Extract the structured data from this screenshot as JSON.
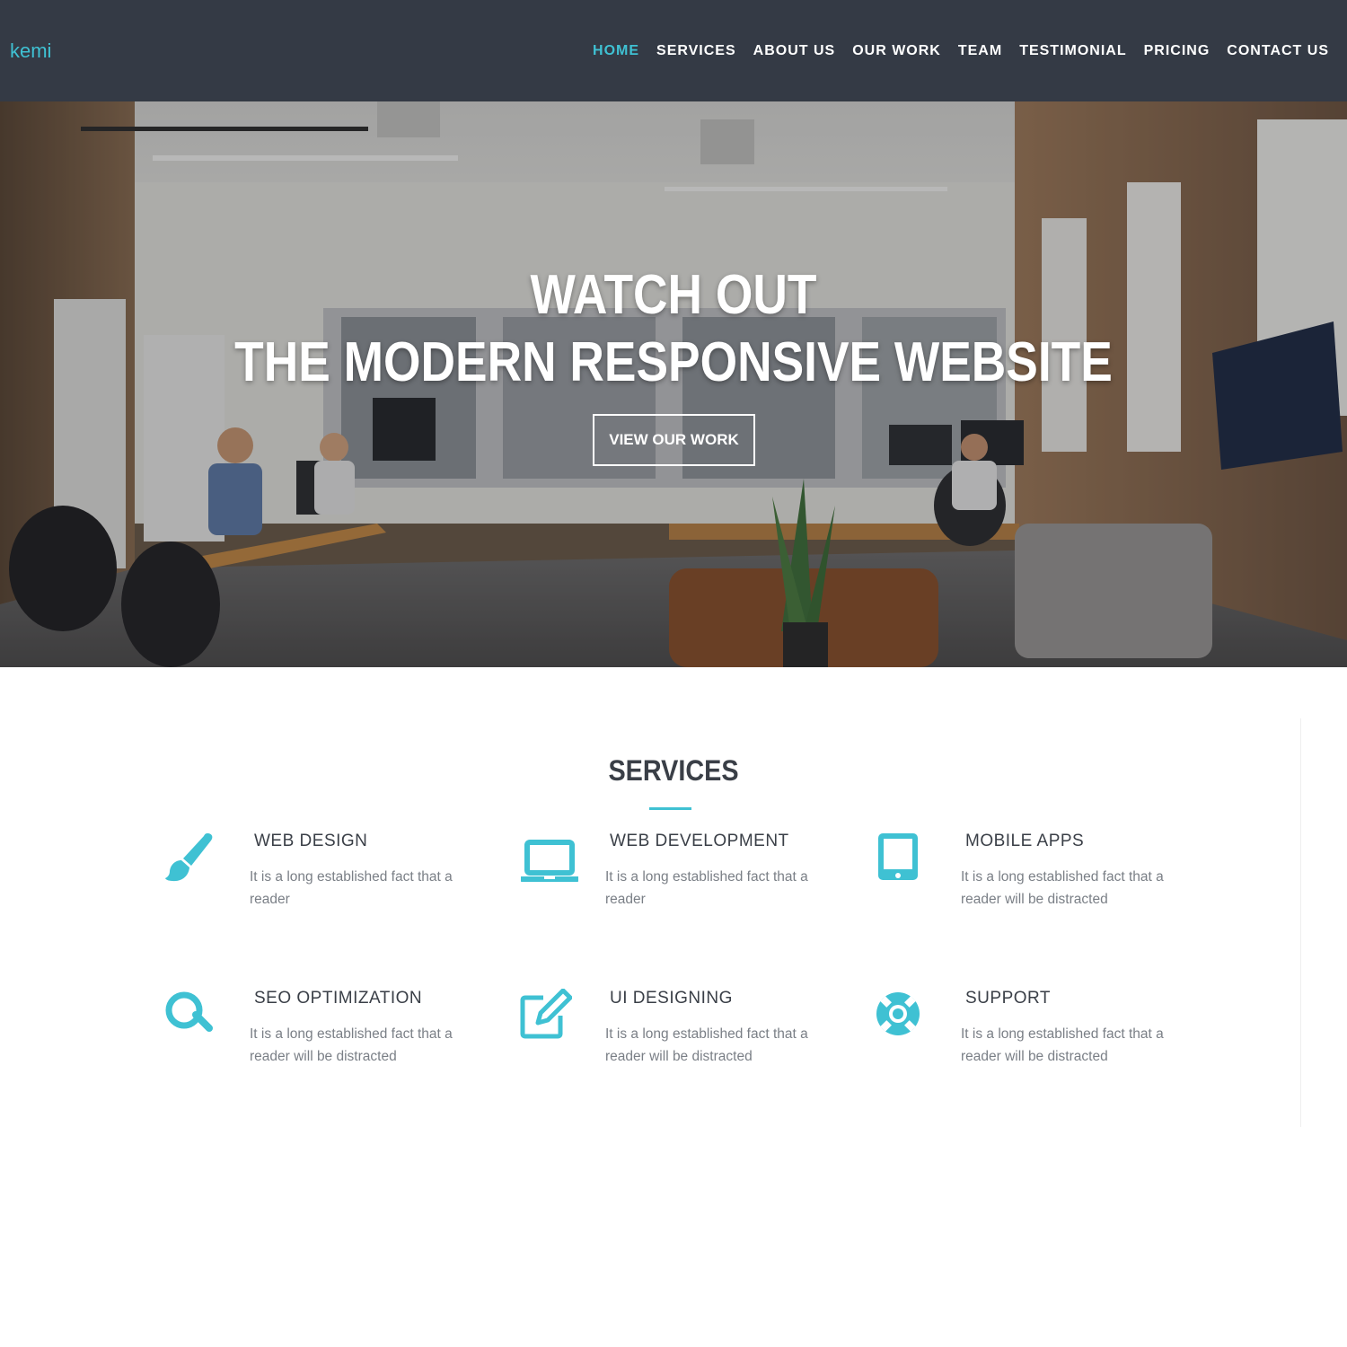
{
  "brand": "kemi",
  "nav": {
    "items": [
      {
        "label": "HOME",
        "active": true
      },
      {
        "label": "SERVICES",
        "active": false
      },
      {
        "label": "ABOUT US",
        "active": false
      },
      {
        "label": "OUR WORK",
        "active": false
      },
      {
        "label": "TEAM",
        "active": false
      },
      {
        "label": "TESTIMONIAL",
        "active": false
      },
      {
        "label": "PRICING",
        "active": false
      },
      {
        "label": "CONTACT US",
        "active": false
      }
    ]
  },
  "hero": {
    "line1": "WATCH OUT",
    "line2": "THE MODERN RESPONSIVE WEBSITE",
    "button_label": "VIEW OUR WORK"
  },
  "services": {
    "title": "SERVICES",
    "items": [
      {
        "title": "WEB DESIGN",
        "text": "It is a long established fact that a reader",
        "icon": "paintbrush-icon"
      },
      {
        "title": "WEB DEVELOPMENT",
        "text": "It is a long established fact that a reader",
        "icon": "laptop-icon"
      },
      {
        "title": "MOBILE APPS",
        "text": "It is a long established fact that a reader will be distracted",
        "icon": "tablet-icon"
      },
      {
        "title": "SEO OPTIMIZATION",
        "text": "It is a long established fact that a reader will be distracted",
        "icon": "search-icon"
      },
      {
        "title": "UI DESIGNING",
        "text": "It is a long established fact that a reader will be distracted",
        "icon": "edit-icon"
      },
      {
        "title": "SUPPORT",
        "text": "It is a long established fact that a reader will be distracted",
        "icon": "lifebuoy-icon"
      }
    ]
  },
  "colors": {
    "accent": "#3fc1d3",
    "navbar_bg": "#343a45",
    "heading": "#3a3f47",
    "body_text": "#7a7f86"
  }
}
